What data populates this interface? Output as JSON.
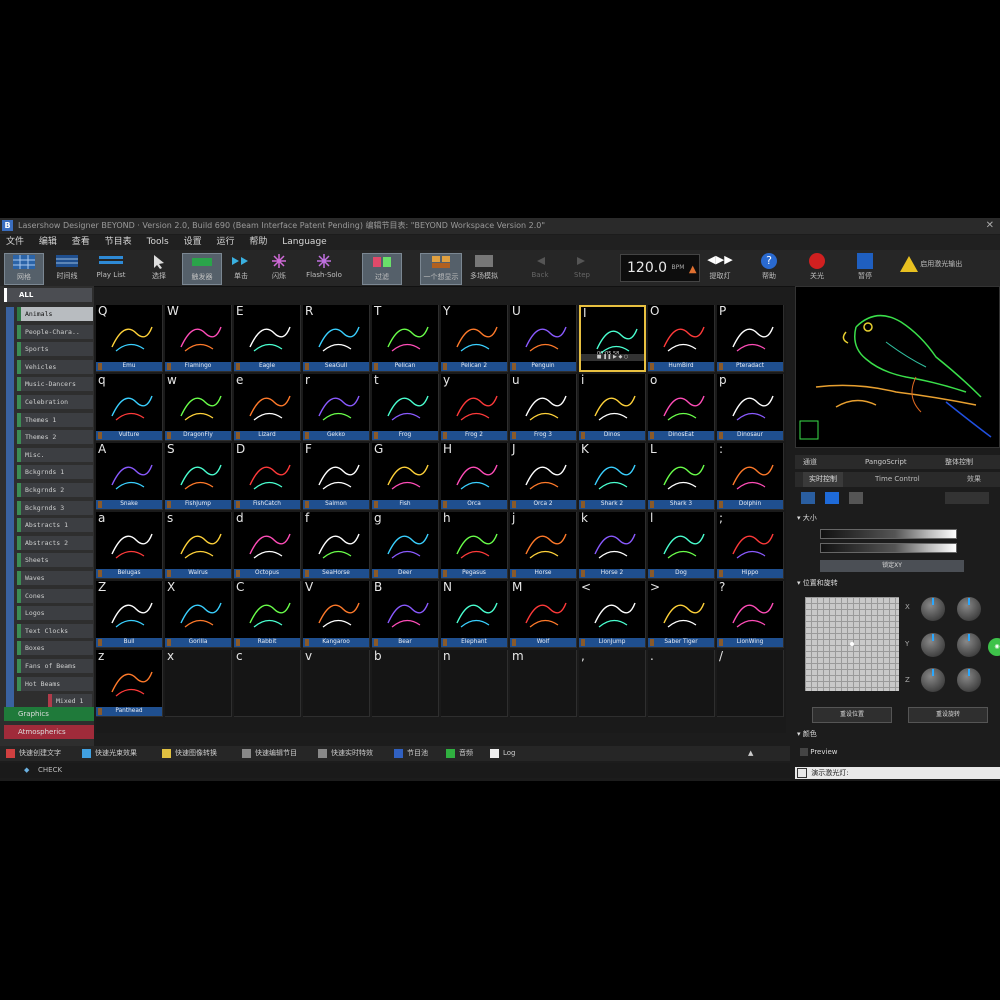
{
  "window": {
    "title": "Lasershow Designer BEYOND · Version 2.0, Build 690 (Beam Interface Patent Pending) 编辑节目表: \"BEYOND Workspace Version 2.0\"",
    "logo": "B",
    "close": "✕"
  },
  "menu": [
    "文件",
    "编辑",
    "查看",
    "节目表",
    "Tools",
    "设置",
    "运行",
    "帮助",
    "Language"
  ],
  "toolbar": {
    "buttons": [
      {
        "label": "网格",
        "active": true
      },
      {
        "label": "时间线",
        "active": false
      },
      {
        "label": "Play List",
        "active": false
      },
      {
        "label": "选择",
        "active": false
      },
      {
        "label": "触发器",
        "active": true
      },
      {
        "label": "单击",
        "active": false
      },
      {
        "label": "闪烁",
        "active": false
      },
      {
        "label": "Flash-Solo",
        "active": false
      },
      {
        "label": "过滤",
        "active": true
      },
      {
        "label": "一个想显示",
        "active": false
      },
      {
        "label": "多场模拟",
        "active": false
      },
      {
        "label": "Back",
        "active": false
      },
      {
        "label": "Step",
        "active": false
      }
    ],
    "bpm": "120.0",
    "bpm_unit": "BPM",
    "right_buttons": [
      "提取灯",
      "帮助",
      "关光",
      "暂停",
      "启用激光输出"
    ]
  },
  "categories": {
    "all": "ALL",
    "items": [
      {
        "label": "Animals",
        "selected": true
      },
      {
        "label": "People-Chara..",
        "selected": false
      },
      {
        "label": "Sports",
        "selected": false
      },
      {
        "label": "Vehicles",
        "selected": false
      },
      {
        "label": "Music-Dancers",
        "selected": false
      },
      {
        "label": "Celebration",
        "selected": false
      },
      {
        "label": "Themes 1",
        "selected": false
      },
      {
        "label": "Themes 2",
        "selected": false
      },
      {
        "label": "Misc.",
        "selected": false
      },
      {
        "label": "Bckgrnds 1",
        "selected": false
      },
      {
        "label": "Bckgrnds 2",
        "selected": false
      },
      {
        "label": "Bckgrnds 3",
        "selected": false
      },
      {
        "label": "Abstracts 1",
        "selected": false
      },
      {
        "label": "Abstracts 2",
        "selected": false
      },
      {
        "label": "Sheets",
        "selected": false
      },
      {
        "label": "Waves",
        "selected": false
      },
      {
        "label": "Cones",
        "selected": false
      },
      {
        "label": "Logos",
        "selected": false
      },
      {
        "label": "Text Clocks",
        "selected": false
      },
      {
        "label": "Boxes",
        "selected": false
      },
      {
        "label": "Fans of Beams",
        "selected": false
      },
      {
        "label": "Hot Beams",
        "selected": false
      },
      {
        "label": "Mixed 1",
        "selected": false
      }
    ],
    "groups": [
      "Graphics",
      "Atmospherics"
    ]
  },
  "grid": {
    "rows": [
      [
        {
          "key": "Q",
          "name": "Emu"
        },
        {
          "key": "W",
          "name": "Flamingo"
        },
        {
          "key": "E",
          "name": "Eagle"
        },
        {
          "key": "R",
          "name": "SeaGull"
        },
        {
          "key": "T",
          "name": "Pelican"
        },
        {
          "key": "Y",
          "name": "Pelican 2"
        },
        {
          "key": "U",
          "name": "Penguin"
        },
        {
          "key": "I",
          "name": "",
          "selected": true
        },
        {
          "key": "O",
          "name": "HumBird"
        },
        {
          "key": "P",
          "name": "Pteradact"
        }
      ],
      [
        {
          "key": "q",
          "name": "Vulture"
        },
        {
          "key": "w",
          "name": "DragonFly"
        },
        {
          "key": "e",
          "name": "Lizard"
        },
        {
          "key": "r",
          "name": "Gekko"
        },
        {
          "key": "t",
          "name": "Frog"
        },
        {
          "key": "y",
          "name": "Frog 2"
        },
        {
          "key": "u",
          "name": "Frog 3"
        },
        {
          "key": "i",
          "name": "Dinos"
        },
        {
          "key": "o",
          "name": "DinosEat"
        },
        {
          "key": "p",
          "name": "Dinosaur"
        }
      ],
      [
        {
          "key": "A",
          "name": "Snake"
        },
        {
          "key": "S",
          "name": "FishJump"
        },
        {
          "key": "D",
          "name": "FishCatch"
        },
        {
          "key": "F",
          "name": "Salmon"
        },
        {
          "key": "G",
          "name": "Fish"
        },
        {
          "key": "H",
          "name": "Orca"
        },
        {
          "key": "J",
          "name": "Orca 2"
        },
        {
          "key": "K",
          "name": "Shark 2"
        },
        {
          "key": "L",
          "name": "Shark 3"
        },
        {
          "key": ":",
          "name": "Dolphin"
        }
      ],
      [
        {
          "key": "a",
          "name": "Belugas"
        },
        {
          "key": "s",
          "name": "Walrus"
        },
        {
          "key": "d",
          "name": "Octopus"
        },
        {
          "key": "f",
          "name": "SeaHorse"
        },
        {
          "key": "g",
          "name": "Deer"
        },
        {
          "key": "h",
          "name": "Pegasus"
        },
        {
          "key": "j",
          "name": "Horse"
        },
        {
          "key": "k",
          "name": "Horse 2"
        },
        {
          "key": "l",
          "name": "Dog"
        },
        {
          "key": ";",
          "name": "Hippo"
        }
      ],
      [
        {
          "key": "Z",
          "name": "Bull"
        },
        {
          "key": "X",
          "name": "Gorilla"
        },
        {
          "key": "C",
          "name": "Rabbit"
        },
        {
          "key": "V",
          "name": "Kangaroo"
        },
        {
          "key": "B",
          "name": "Bear"
        },
        {
          "key": "N",
          "name": "Elephant"
        },
        {
          "key": "M",
          "name": "Wolf"
        },
        {
          "key": "<",
          "name": "LionJump"
        },
        {
          "key": ">",
          "name": "Saber Tiger"
        },
        {
          "key": "?",
          "name": "LionWing"
        }
      ],
      [
        {
          "key": "z",
          "name": "Panthead"
        },
        {
          "key": "x",
          "name": ""
        },
        {
          "key": "c",
          "name": ""
        },
        {
          "key": "v",
          "name": ""
        },
        {
          "key": "b",
          "name": ""
        },
        {
          "key": "n",
          "name": ""
        },
        {
          "key": "m",
          "name": ""
        },
        {
          "key": ",",
          "name": ""
        },
        {
          "key": ".",
          "name": ""
        },
        {
          "key": "/",
          "name": ""
        }
      ]
    ],
    "selected_time": "00:05.58"
  },
  "right": {
    "tabs": [
      "通道",
      "PangoScript",
      "整体控制"
    ],
    "tabs2": [
      "实时控制",
      "Time Control",
      "效果"
    ],
    "size_label": "大小",
    "reset_xy": "锁定XY",
    "position_label": "位置和旋转",
    "axes": [
      "X",
      "Y",
      "Z"
    ],
    "reset_position": "重设位置",
    "reset_rotation": "重设旋转",
    "color_label": "颜色",
    "preview_label": "Preview",
    "show_beams": "演示激光灯:"
  },
  "bottom": {
    "tabs": [
      "快速创建文字",
      "快速光束效果",
      "快速图像转换",
      "快速编辑节目",
      "快速实时特效",
      "节目池",
      "音频",
      "Log"
    ],
    "status": "CHECK"
  }
}
